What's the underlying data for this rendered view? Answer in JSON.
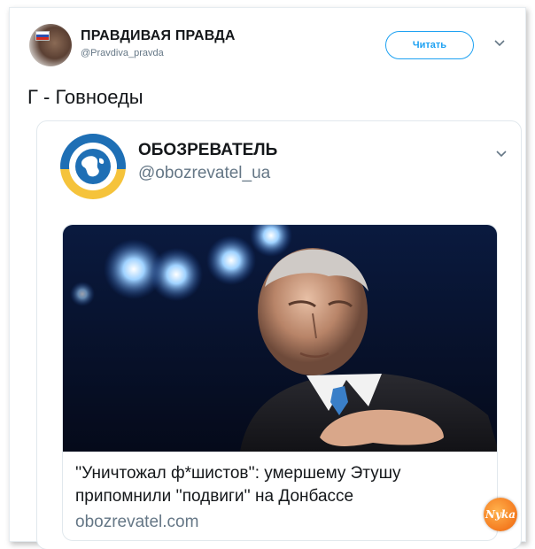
{
  "tweet": {
    "author_name": "ПРАВДИВАЯ ПРАВДА",
    "author_handle": "@Pravdiva_pravda",
    "follow_label": "Читать",
    "text": "Г - Говноеды"
  },
  "embed": {
    "source_name": "ОБОЗРЕВАТЕЛЬ",
    "source_handle": "@obozrevatel_ua",
    "card": {
      "title": "''Уничтожал ф*шистов'': умершему Этушу припомнили ''подвиги'' на Донбассе",
      "domain": "obozrevatel.com"
    }
  },
  "watermark": {
    "text": "Nyka"
  },
  "colors": {
    "accent": "#1da1f2",
    "muted": "#657786",
    "logo_blue": "#1e6fb5",
    "logo_yellow": "#f5c33b"
  },
  "icons": {
    "header_menu": "chevron-down-icon",
    "embed_menu": "chevron-down-icon"
  }
}
